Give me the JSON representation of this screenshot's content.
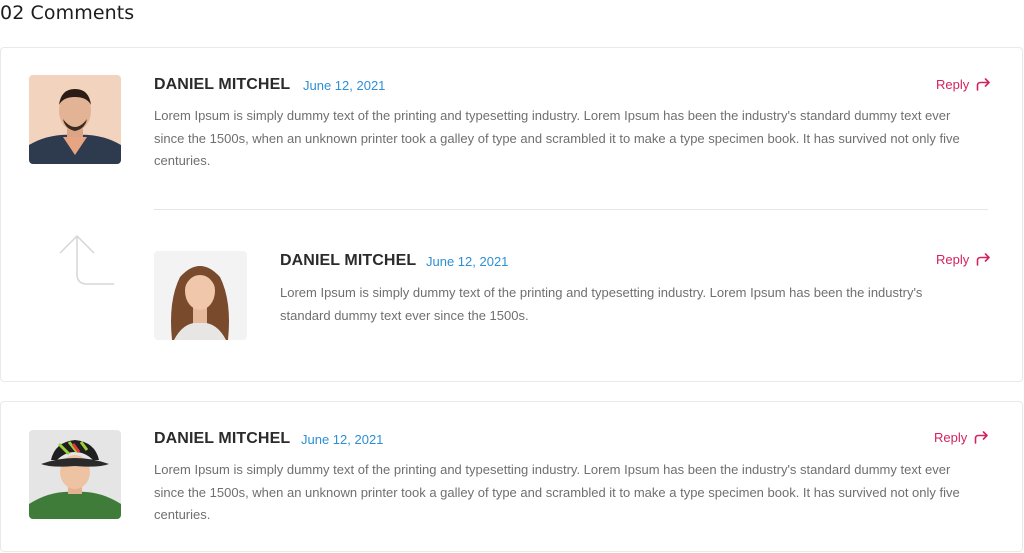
{
  "heading": "02 Comments",
  "comments": [
    {
      "name": "DANIEL MITCHEL",
      "date": "June 12, 2021",
      "reply": "Reply",
      "text": "Lorem Ipsum is simply dummy text of the printing and typesetting industry. Lorem Ipsum has been the industry's standard dummy text ever since the 1500s, when an unknown printer took a galley of type and scrambled it to make a type specimen book. It has survived not only five centuries."
    },
    {
      "name": "DANIEL MITCHEL",
      "date": "June 12, 2021",
      "reply": "Reply",
      "text": "Lorem Ipsum is simply dummy text of the printing and typesetting industry. Lorem Ipsum has been the industry's standard dummy text ever since the 1500s."
    },
    {
      "name": "DANIEL MITCHEL",
      "date": "June 12, 2021",
      "reply": "Reply",
      "text": "Lorem Ipsum is simply dummy text of the printing and typesetting industry. Lorem Ipsum has been the industry's standard dummy text ever since the 1500s, when an unknown printer took a galley of type and scrambled it to make a type specimen book. It has survived not only five centuries."
    }
  ],
  "colors": {
    "accent_date": "#2d8fd5",
    "accent_reply": "#d4235c",
    "body_text": "#6f6f6f"
  },
  "icons": {
    "reply": "reply-arrow-icon",
    "nested": "nested-reply-arrow-icon"
  }
}
